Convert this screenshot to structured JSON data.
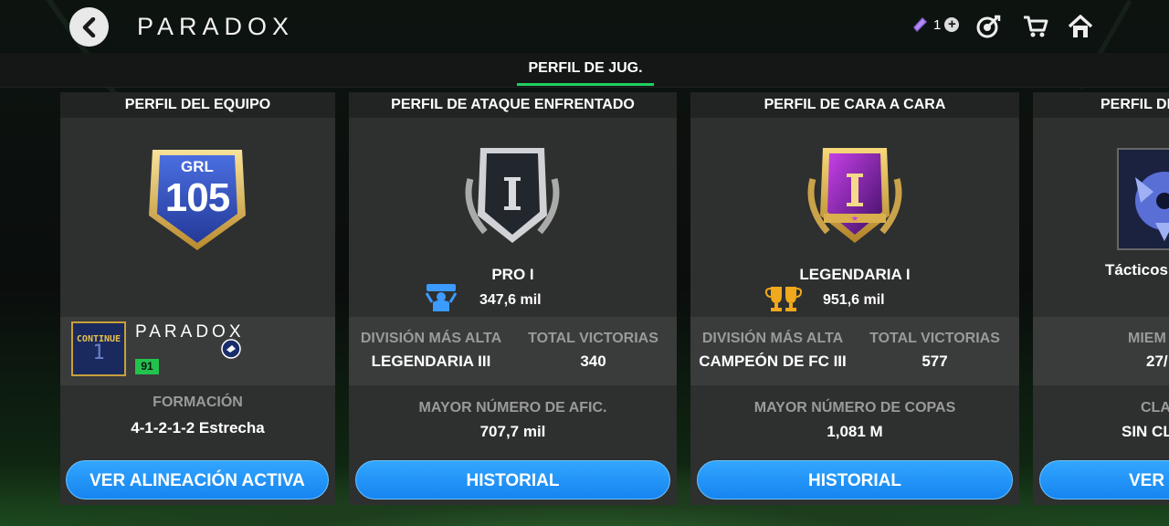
{
  "header": {
    "title": "PARADOX",
    "currency_count": "1"
  },
  "tabs": [
    {
      "label": "PERFIL DE JUG.",
      "active": true
    }
  ],
  "colors": {
    "accent": "#20d060",
    "button": "#1a8cf5",
    "card_bg": "#2e2f2f"
  },
  "team_card": {
    "heading": "PERFIL DEL EQUIPO",
    "badge_label": "GRL",
    "badge_value": "105",
    "club_logo_text": "CONTINUE",
    "club_logo_digit": "1",
    "club_name": "PARADOX",
    "rating": "91",
    "formation_label": "FORMACIÓN",
    "formation_value": "4-1-2-1-2 Estrecha",
    "button": "VER ALINEACIÓN ACTIVA"
  },
  "rivals_card": {
    "heading": "PERFIL DE ATAQUE ENFRENTADO",
    "rank": "PRO I",
    "score": "347,6 mil",
    "col1_label": "DIVISIÓN MÁS ALTA",
    "col1_value": "LEGENDARIA III",
    "col2_label": "TOTAL VICTORIAS",
    "col2_value": "340",
    "stat_label": "MAYOR NÚMERO DE AFIC.",
    "stat_value": "707,7 mil",
    "button": "HISTORIAL"
  },
  "h2h_card": {
    "heading": "PERFIL DE CARA A CARA",
    "rank": "LEGENDARIA I",
    "score": "951,6 mil",
    "col1_label": "DIVISIÓN MÁS ALTA",
    "col1_value": "CAMPEÓN DE FC III",
    "col2_label": "TOTAL VICTORIAS",
    "col2_value": "577",
    "stat_label": "MAYOR NÚMERO DE COPAS",
    "stat_value": "1,081 M",
    "button": "HISTORIAL"
  },
  "league_card": {
    "heading": "PERFIL DE",
    "subtitle": "Tácticos",
    "col_label": "MIEM",
    "col_value": "27/",
    "stat_label": "CLA",
    "stat_value": "SIN CL",
    "button": "VER"
  }
}
